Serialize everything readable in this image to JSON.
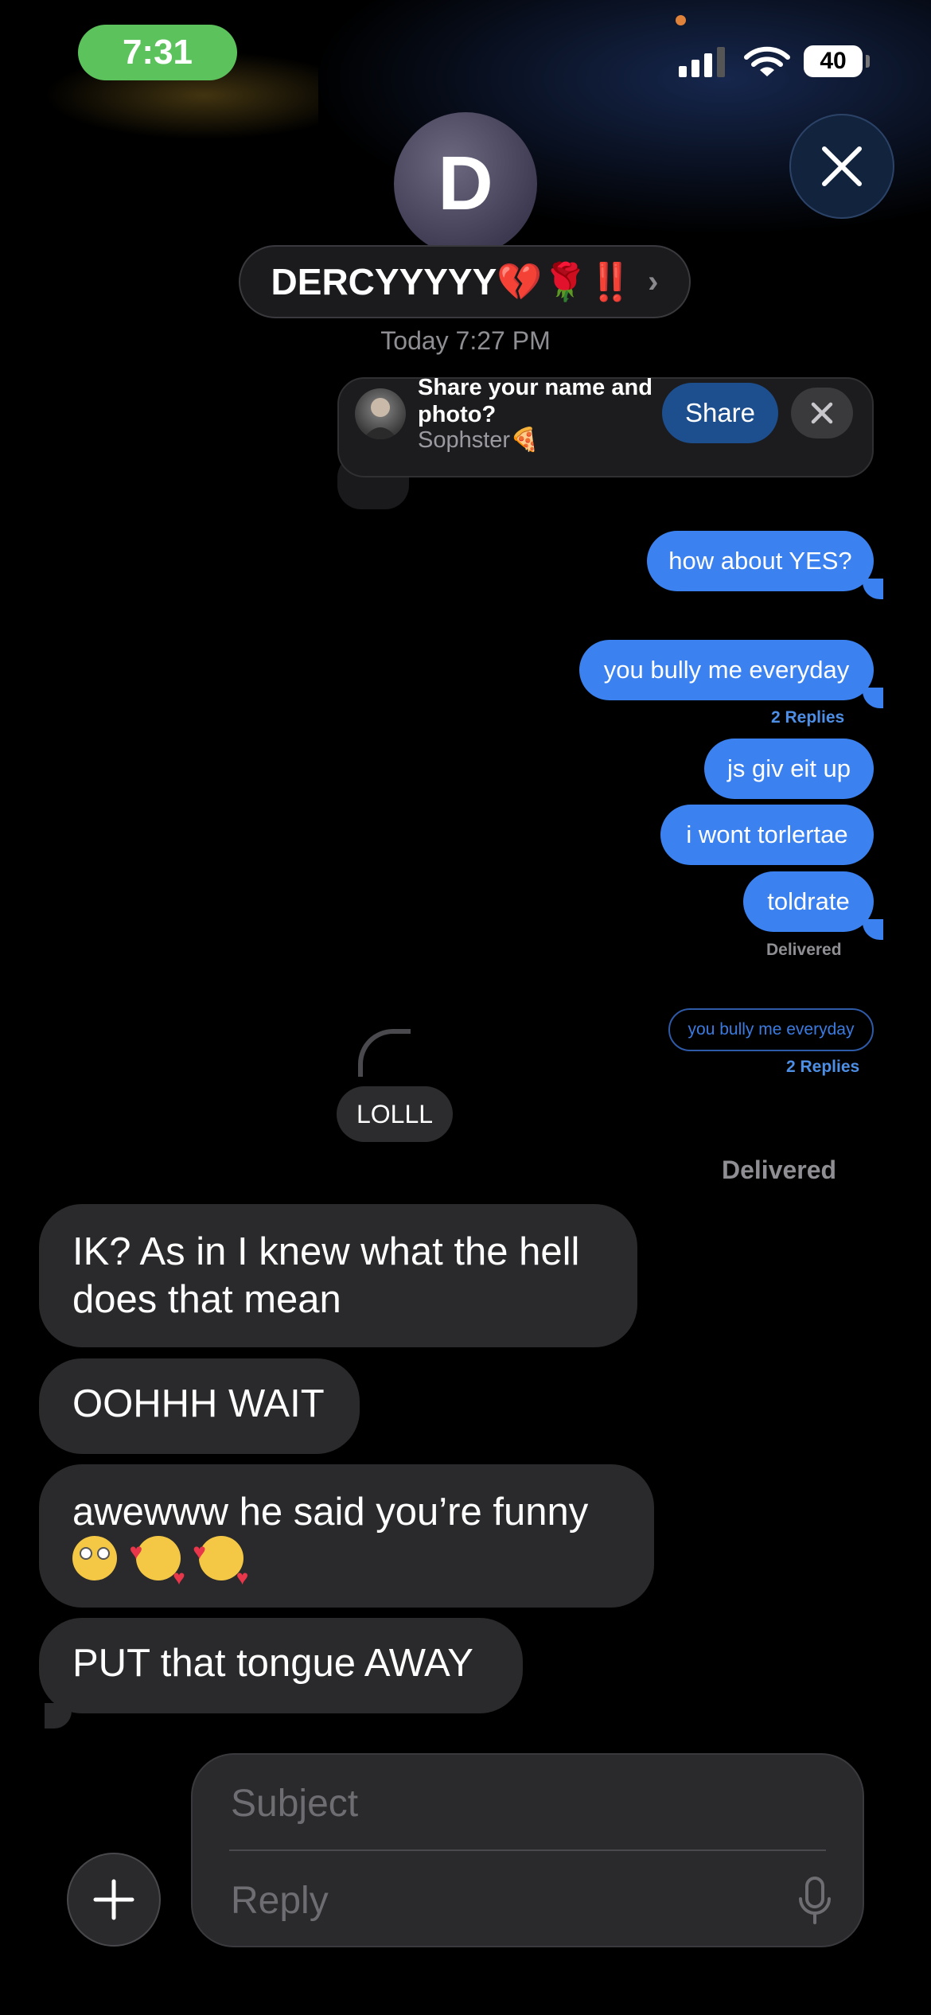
{
  "status_bar": {
    "time": "7:31",
    "battery": "40",
    "icons": [
      "cellular-signal-icon",
      "wifi-icon",
      "battery-icon"
    ]
  },
  "header": {
    "avatar_initial": "D",
    "contact_name": "DERCYYYYY💔🌹‼️",
    "chevron": "›",
    "close_icon": "close-icon"
  },
  "conversation": {
    "timestamp": "Today 7:27 PM"
  },
  "share_banner": {
    "title": "Share your name and photo?",
    "subtitle": "Sophster🍕",
    "share_label": "Share",
    "dismiss_icon": "close-icon"
  },
  "messages_out": [
    {
      "text": "how about YES?"
    },
    {
      "text": "you bully me everyday"
    },
    {
      "text": "js giv eit up"
    },
    {
      "text": "i wont torlertae"
    },
    {
      "text": "toldrate"
    }
  ],
  "replies_label_1": "2 Replies",
  "delivered_small": "Delivered",
  "quoted_bubble": {
    "text": "you bully me everyday",
    "replies_label": "2 Replies"
  },
  "reply_message": "LOLLL",
  "delivered_big": "Delivered",
  "messages_in": [
    {
      "text": "IK? As in I knew what the hell does that mean"
    },
    {
      "text": "OOHHH WAIT"
    },
    {
      "text": "awewww he said you’re funny"
    },
    {
      "text": "PUT that tongue AWAY"
    }
  ],
  "composer": {
    "subject_placeholder": "Subject",
    "reply_placeholder": "Reply",
    "plus_icon": "plus-icon",
    "mic_icon": "microphone-icon"
  },
  "colors": {
    "outgoing_bubble": "#3b82f0",
    "incoming_bubble": "#2a2a2c",
    "status_time_pill": "#5cc35c",
    "share_button": "#1d4f8f"
  }
}
